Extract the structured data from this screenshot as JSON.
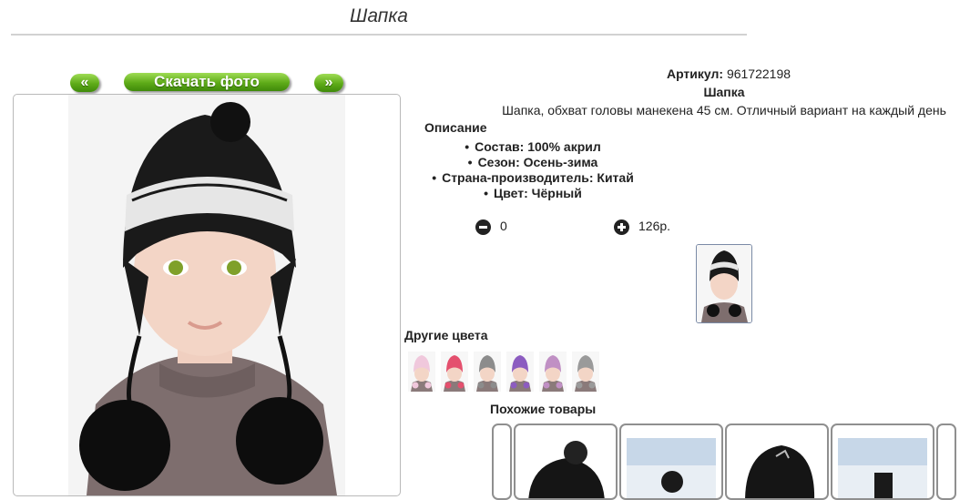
{
  "page": {
    "title": "Шапка"
  },
  "nav": {
    "prev_label": "«",
    "download_label": "Скачать фото",
    "next_label": "»"
  },
  "product": {
    "article_label": "Артикул:",
    "article_value": "961722198",
    "name": "Шапка",
    "description": "Шапка, обхват головы манекена 45 см. Отличный вариант на каждый день",
    "description_heading": "Описание",
    "attributes": [
      "Состав: 100% акрил",
      "Сезон: Осень-зима",
      "Страна-производитель: Китай",
      "Цвет: Чёрный"
    ],
    "quantity": "0",
    "price": "126р."
  },
  "other_colors": {
    "heading": "Другие цвета",
    "swatches": [
      {
        "color": "#f0c8dc"
      },
      {
        "color": "#e4506e"
      },
      {
        "color": "#8c8c8c"
      },
      {
        "color": "#8c5cc0"
      },
      {
        "color": "#c090c4"
      },
      {
        "color": "#9a9a9a"
      }
    ]
  },
  "similar": {
    "heading": "Похожие товары"
  },
  "colors": {
    "accent_green": "#5eab18",
    "text": "#222222"
  },
  "icons": {
    "minus": "minus-circle-icon",
    "plus": "plus-circle-icon"
  }
}
